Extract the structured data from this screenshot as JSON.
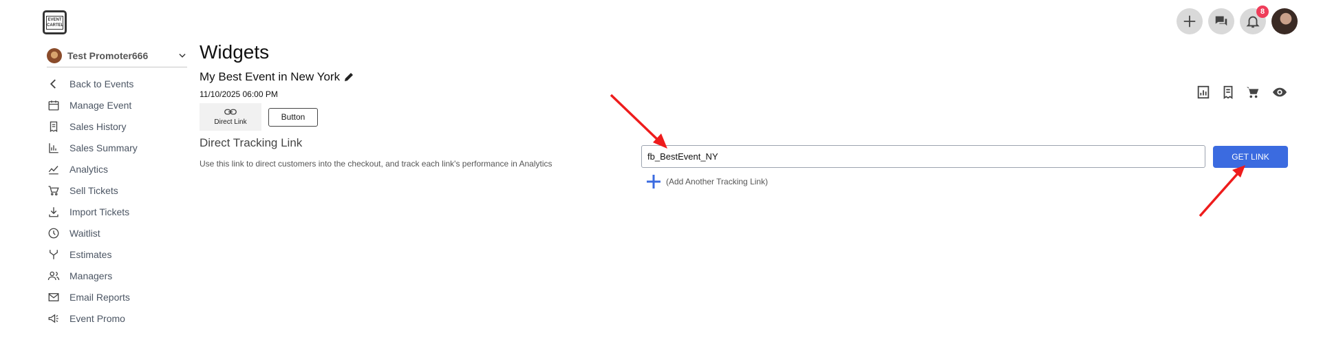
{
  "logo": {
    "text": "EVENT CARTEL"
  },
  "header": {
    "notifications_count": "8",
    "icons": [
      "plus-icon",
      "chat-icon",
      "bell-icon",
      "avatar"
    ]
  },
  "sidebar": {
    "promoter_name": "Test Promoter666",
    "items": [
      {
        "label": "Back to Events",
        "icon": "chevron-left-icon"
      },
      {
        "label": "Manage Event",
        "icon": "calendar-icon"
      },
      {
        "label": "Sales History",
        "icon": "receipt-icon"
      },
      {
        "label": "Sales Summary",
        "icon": "bar-chart-icon"
      },
      {
        "label": "Analytics",
        "icon": "line-chart-icon"
      },
      {
        "label": "Sell Tickets",
        "icon": "cart-icon"
      },
      {
        "label": "Import Tickets",
        "icon": "download-icon"
      },
      {
        "label": "Waitlist",
        "icon": "clock-icon"
      },
      {
        "label": "Estimates",
        "icon": "merge-icon"
      },
      {
        "label": "Managers",
        "icon": "users-icon"
      },
      {
        "label": "Email Reports",
        "icon": "mail-icon"
      },
      {
        "label": "Event Promo",
        "icon": "megaphone-icon"
      }
    ]
  },
  "main": {
    "title": "Widgets",
    "event_name": "My Best Event in New York",
    "event_date": "11/10/2025 06:00 PM",
    "tabs": {
      "direct_link": "Direct Link",
      "button": "Button"
    },
    "section_title": "Direct Tracking Link",
    "section_desc": "Use this link to direct customers into the checkout, and track each link's performance in Analytics",
    "tracking_input_value": "fb_BestEvent_NY",
    "get_link_label": "GET LINK",
    "add_link_label": "(Add Another Tracking Link)"
  },
  "colors": {
    "accent": "#3b6be0",
    "arrow": "#ee1c1c",
    "badge": "#ef3d5a"
  }
}
